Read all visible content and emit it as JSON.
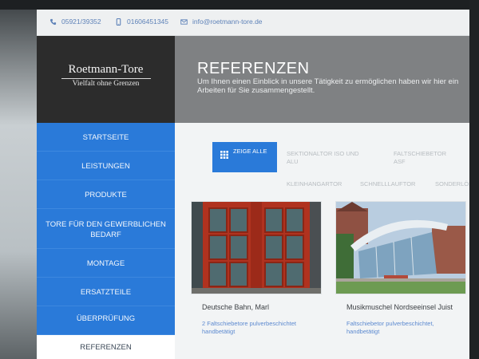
{
  "contact": {
    "phone": "05921/39352",
    "mobile": "01606451345",
    "email": "info@roetmann-tore.de"
  },
  "logo": {
    "name": "Roetmann-Tore",
    "tagline": "Vielfalt ohne Grenzen"
  },
  "header": {
    "title": "REFERENZEN",
    "subtitle": "Um Ihnen einen Einblick in unsere Tätigkeit zu ermöglichen haben wir hier ein Arbeiten für Sie zusammengestellt."
  },
  "nav": {
    "items": [
      {
        "label": "STARTSEITE"
      },
      {
        "label": "LEISTUNGEN"
      },
      {
        "label": "PRODUKTE"
      },
      {
        "label": "TORE FÜR DEN GEWERBLICHEN BEDARF"
      },
      {
        "label": "MONTAGE"
      },
      {
        "label": "ERSATZTEILE"
      },
      {
        "label": "ÜBERPRÜFUNG"
      },
      {
        "label": "REFERENZEN"
      }
    ]
  },
  "filters": {
    "show_all": "ZEIGE ALLE",
    "items": [
      {
        "label": "SEKTIONALTOR ISO UND ALU"
      },
      {
        "label": "FALTSCHIEBETOR ASF"
      },
      {
        "label": "KLEINHANGARTOR"
      },
      {
        "label": "SCHNELLLAUFTOR"
      },
      {
        "label": "SONDERLÖSUNGEN"
      }
    ]
  },
  "cards": [
    {
      "title": "Deutsche Bahn, Marl",
      "desc": "2 Faltschiebetore pulverbeschichtet handbetätigt"
    },
    {
      "title": "Musikmuschel Nordseeinsel Juist",
      "desc": "Faltschiebetor pulverbeschichtet, handbetätigt"
    }
  ],
  "colors": {
    "accent": "#2a7ad9",
    "header_bg": "#7f8183",
    "logo_bg": "#2c2c2c",
    "link": "#5d8ad0"
  },
  "icons": {
    "phone": "phone-icon",
    "mobile": "mobile-icon",
    "email": "envelope-icon",
    "grid": "grid-icon"
  }
}
